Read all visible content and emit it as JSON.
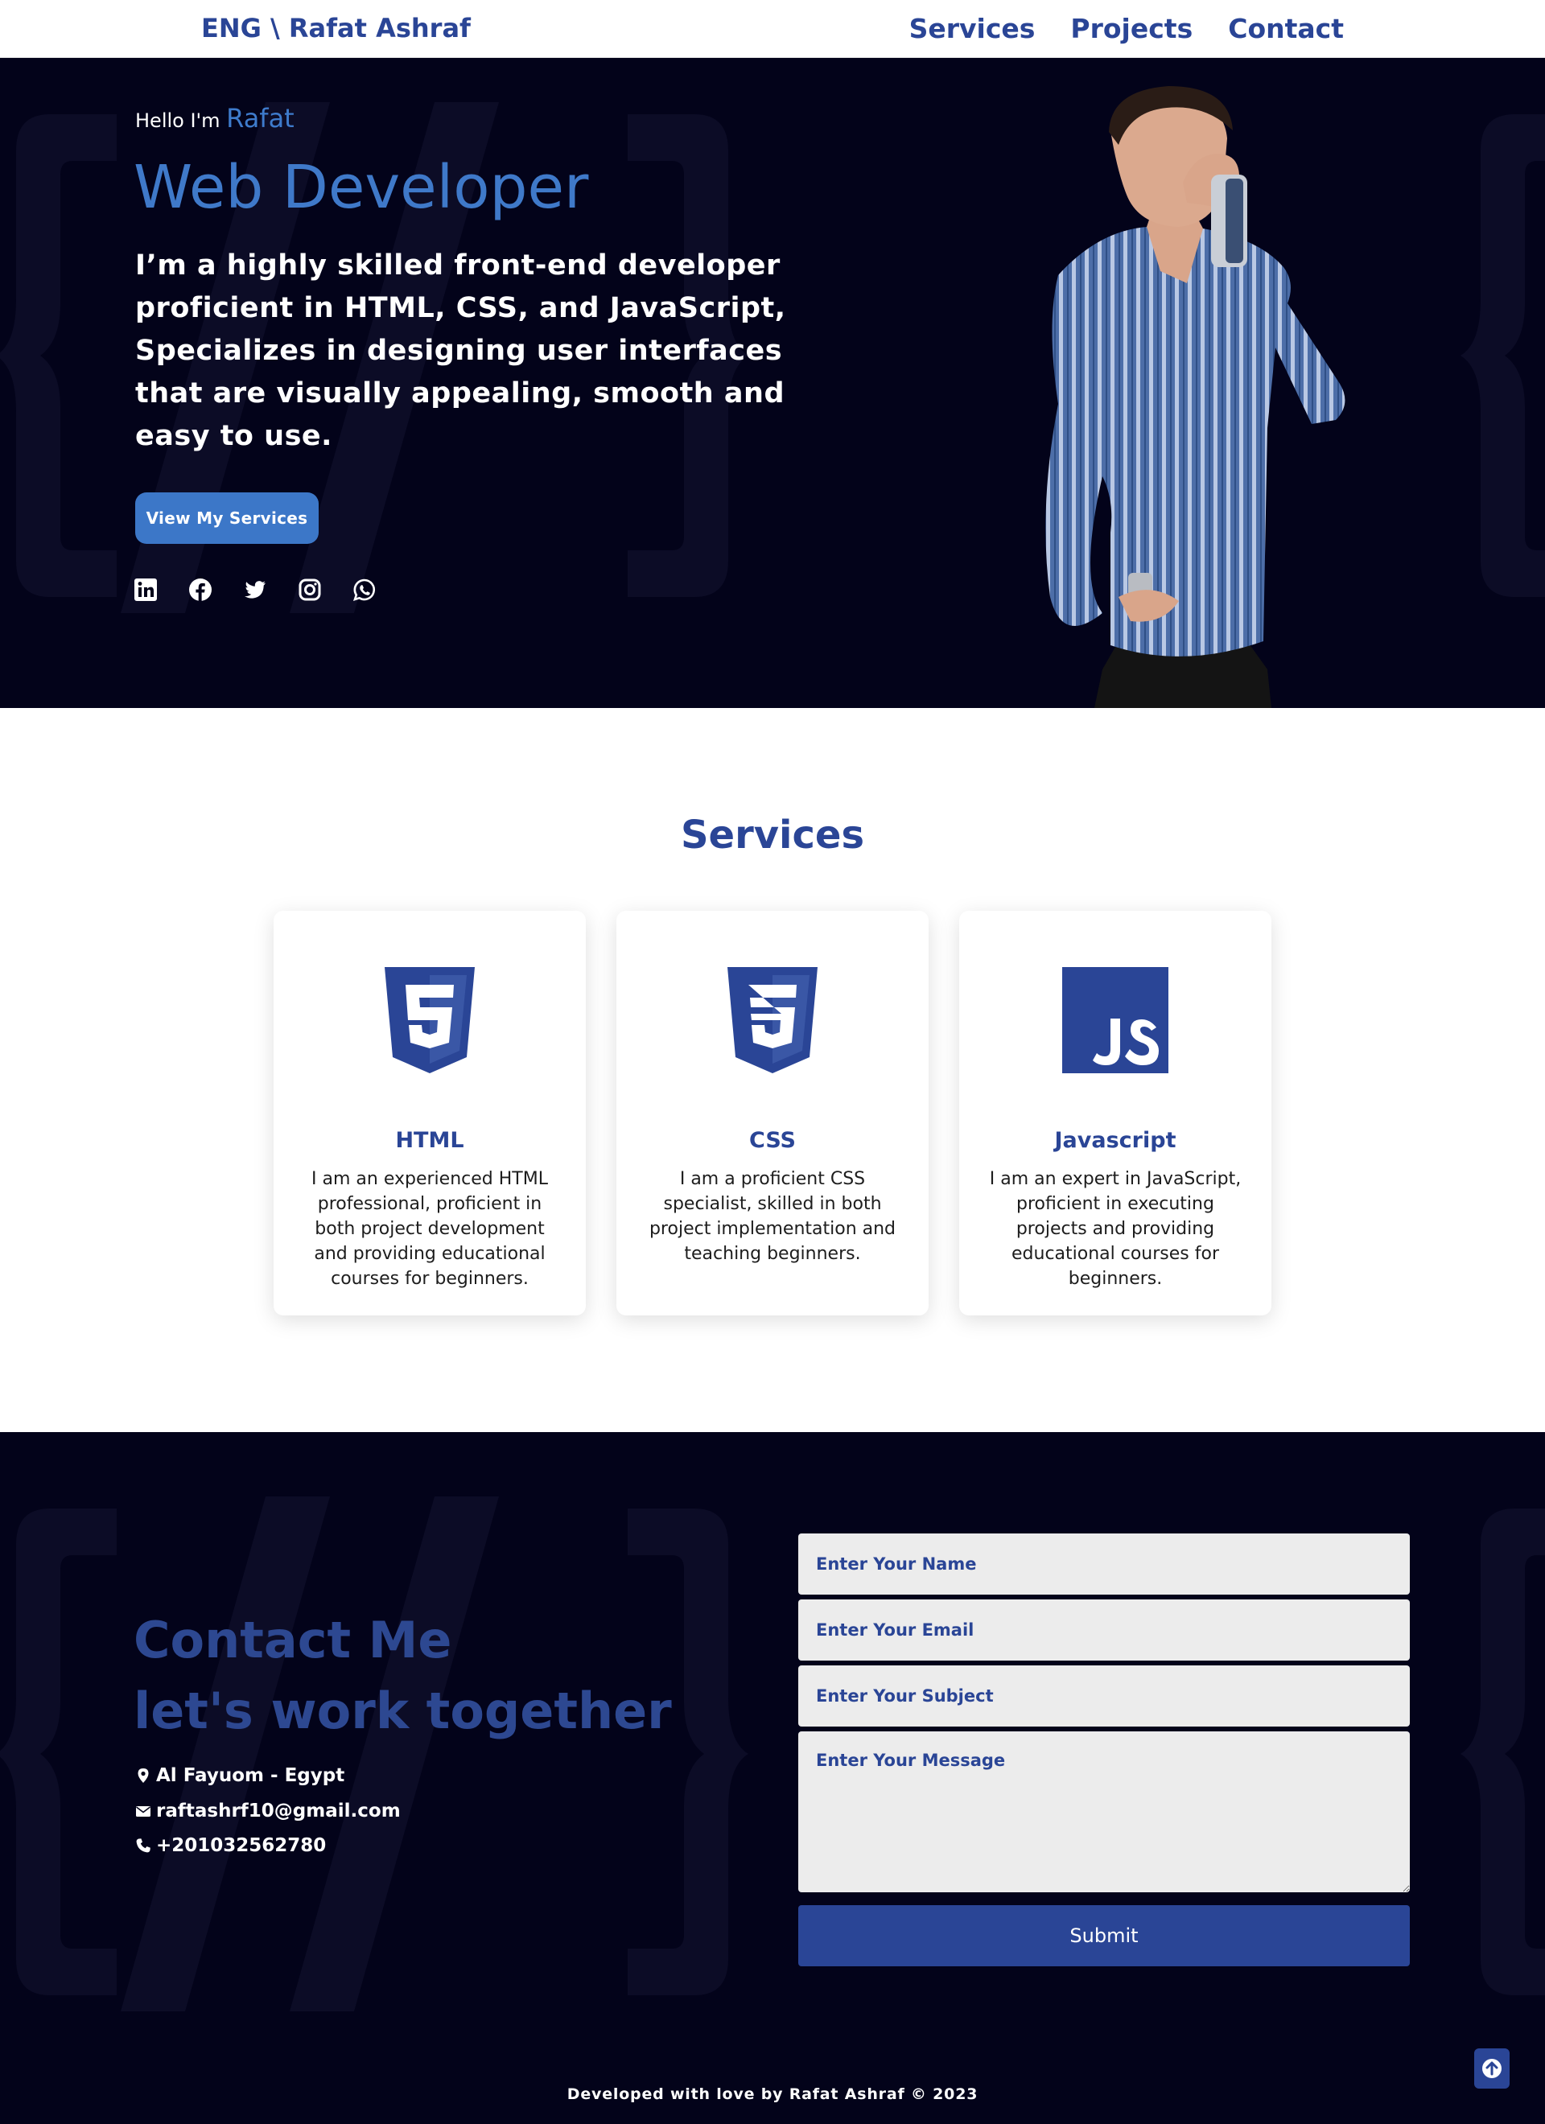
{
  "navbar": {
    "brand": "ENG \\ Rafat Ashraf",
    "links": [
      "Services",
      "Projects",
      "Contact"
    ]
  },
  "hero": {
    "greeting": "Hello I'm",
    "name": "Rafat",
    "title": "Web Developer",
    "description": "I’m a highly skilled front-end developer proficient in HTML, CSS, and JavaScript, Specializes in designing user interfaces that are visually appealing, smooth and easy to use.",
    "button_label": "View My Services",
    "social_icons": [
      "linkedin-icon",
      "facebook-icon",
      "twitter-icon",
      "instagram-icon",
      "whatsapp-icon"
    ]
  },
  "services": {
    "title": "Services",
    "cards": [
      {
        "icon": "html5-icon",
        "title": "HTML",
        "text": "I am an experienced HTML professional, proficient in both project development and providing educational courses for beginners."
      },
      {
        "icon": "css3-icon",
        "title": "CSS",
        "text": "I am a proficient CSS specialist, skilled in both project implementation and teaching beginners."
      },
      {
        "icon": "javascript-icon",
        "title": "Javascript",
        "text": "I am an expert in JavaScript, proficient in executing projects and providing educational courses for beginners."
      }
    ]
  },
  "contact": {
    "title": "Contact Me",
    "subtitle": "let's work together",
    "location": "Al Fayuom - Egypt",
    "email": "raftashrf10@gmail.com",
    "phone": "+201032562780",
    "form": {
      "name_placeholder": "Enter Your Name",
      "email_placeholder": "Enter Your Email",
      "subject_placeholder": "Enter Your Subject",
      "message_placeholder": "Enter Your Message",
      "submit_label": "Submit"
    }
  },
  "footer": {
    "text": "Developed with love by Rafat Ashraf © 2023"
  },
  "colors": {
    "primary": "#2a4596",
    "accent": "#3e7bcc",
    "dark_bg": "#03031a",
    "field_bg": "#ececec"
  }
}
